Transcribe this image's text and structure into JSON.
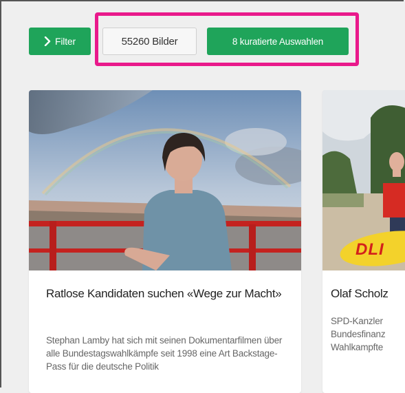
{
  "toolbar": {
    "filter_label": "Filter",
    "image_count_label": "55260 Bilder",
    "curated_label": "8 kuratierte Auswahlen"
  },
  "colors": {
    "accent_green": "#1fa45a",
    "highlight_magenta": "#e9198b"
  },
  "cards": [
    {
      "title": "Ratlose Kandidaten suchen «Wege zur Macht»",
      "teaser": "Stephan Lamby hat sich mit seinen Dokumentarfilmen über alle Bundestagswahlkämpfe seit 1998 eine Art Backstage-Pass für die deutsche Politik"
    },
    {
      "title": "Olaf Scholz",
      "teaser_lines": [
        "SPD-Kanzler",
        "Bundesfinanz",
        "Wahlkampfte"
      ],
      "image_text": "DLI"
    }
  ]
}
